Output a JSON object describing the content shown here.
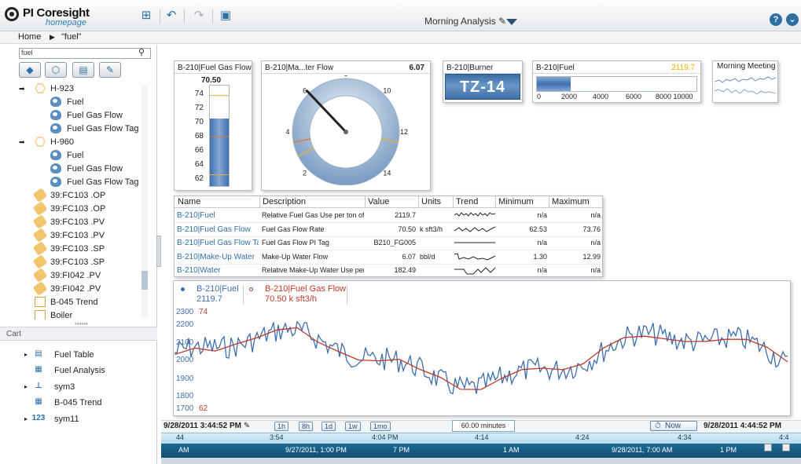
{
  "app": {
    "name": "PI Coresight",
    "subtitle": "homepage"
  },
  "toolbar": {
    "display_title": "Morning Analysis"
  },
  "breadcrumb": {
    "home": "Home",
    "current": "\"fuel\""
  },
  "search": {
    "value": "fuel"
  },
  "tree": [
    {
      "label": "H-923",
      "type": "element",
      "expandable": true
    },
    {
      "label": "Fuel",
      "type": "attribute"
    },
    {
      "label": "Fuel Gas Flow",
      "type": "attribute"
    },
    {
      "label": "Fuel Gas Flow Tag",
      "type": "attribute"
    },
    {
      "label": "H-960",
      "type": "element",
      "expandable": true
    },
    {
      "label": "Fuel",
      "type": "attribute"
    },
    {
      "label": "Fuel Gas Flow",
      "type": "attribute"
    },
    {
      "label": "Fuel Gas Flow Tag",
      "type": "attribute"
    },
    {
      "label": "39:FC103 .OP",
      "type": "tag"
    },
    {
      "label": "39:FC103 .OP",
      "type": "tag"
    },
    {
      "label": "39:FC103 .PV",
      "type": "tag"
    },
    {
      "label": "39:FC103 .PV",
      "type": "tag"
    },
    {
      "label": "39:FC103 .SP",
      "type": "tag"
    },
    {
      "label": "39:FC103 .SP",
      "type": "tag"
    },
    {
      "label": "39:FI042 .PV",
      "type": "tag"
    },
    {
      "label": "39:FI042 .PV",
      "type": "tag"
    },
    {
      "label": "B-045 Trend",
      "type": "display"
    },
    {
      "label": "Boiler",
      "type": "display"
    }
  ],
  "cart": {
    "title": "Cart",
    "items": [
      {
        "label": "Fuel Table",
        "icon": "table-icon",
        "glyph": "▤",
        "expandable": true
      },
      {
        "label": "Fuel Analysis",
        "icon": "display-icon",
        "glyph": "▦",
        "expandable": false
      },
      {
        "label": "sym3",
        "icon": "trend-icon",
        "glyph": "⊥",
        "expandable": true
      },
      {
        "label": "B-045 Trend",
        "icon": "display-icon",
        "glyph": "▦",
        "expandable": false
      },
      {
        "label": "sym11",
        "icon": "value-icon",
        "glyph": "123",
        "expandable": true
      }
    ]
  },
  "tank": {
    "title": "B-210|Fuel Gas Flow",
    "value": "70.50",
    "ticks": [
      "74",
      "72",
      "70",
      "68",
      "66",
      "64",
      "62"
    ],
    "min": 61,
    "max": 75.2,
    "level": 70.5
  },
  "gauge": {
    "title": "B-210|Ma...ter Flow",
    "value": "6.07",
    "ticks": [
      "6",
      "8",
      "10",
      "12",
      "14",
      "2",
      "4"
    ],
    "level": 6.07
  },
  "value_symbol": {
    "title": "B-210|Burner",
    "value": "TZ-14"
  },
  "bar": {
    "title": "B-210|Fuel",
    "value": "2119.7",
    "ticks": [
      "0",
      "2000",
      "4000",
      "6000",
      "8000 10000"
    ],
    "max": 10000,
    "level": 2119.7
  },
  "sparkline": {
    "title": "Morning Meeting"
  },
  "table": {
    "columns": [
      "Name",
      "Description",
      "Value",
      "Units",
      "Trend",
      "Minimum",
      "Maximum"
    ],
    "rows": [
      {
        "name": "B-210|Fuel",
        "desc": "Relative Fuel Gas Use per ton of Fee",
        "value": "2119.7",
        "units": "",
        "min": "n/a",
        "max": "n/a"
      },
      {
        "name": "B-210|Fuel Gas Flow",
        "desc": "Fuel Gas Flow Rate",
        "value": "70.50",
        "units": "k sft3/h",
        "min": "62.53",
        "max": "73.76"
      },
      {
        "name": "B-210|Fuel Gas Flow Ta",
        "desc": "Fuel Gas Flow PI Tag",
        "value": "B210_FG005",
        "units": "",
        "min": "n/a",
        "max": "n/a"
      },
      {
        "name": "B-210|Make-Up Water",
        "desc": "Make-Up Water Flow",
        "value": "6.07",
        "units": "bbl/d",
        "min": "1.30",
        "max": "12.99"
      },
      {
        "name": "B-210|Water",
        "desc": "Relative Make-Up Water Use per tor",
        "value": "182.49",
        "units": "",
        "min": "n/a",
        "max": "n/a"
      }
    ]
  },
  "trend": {
    "legend": [
      {
        "name": "B-210|Fuel",
        "value": "2119.7",
        "color": "#3e6fae"
      },
      {
        "name": "B-210|Fuel Gas Flow",
        "value": "70.50  k sft3/h",
        "color": "#c0392b"
      }
    ],
    "y_left": [
      "2300",
      "2200",
      "2100",
      "2000",
      "1900",
      "1800",
      "1700"
    ],
    "y_right_top": "74",
    "y_right_bottom": "62"
  },
  "timebar": {
    "start": "9/28/2011 3:44:52 PM",
    "end": "9/28/2011 4:44:52 PM",
    "duration": "60.00 minutes",
    "ranges": [
      "1h",
      "8h",
      "1d",
      "1w",
      "1mo"
    ],
    "now_label": "Now",
    "axis_top": [
      "44",
      "3:54",
      "4:04 PM",
      "4:14",
      "4:24",
      "4:34",
      "4:4"
    ],
    "axis_bottom": [
      "AM",
      "9/27/2011, 1:00 PM",
      "7 PM",
      "1 AM",
      "9/28/2011, 7:00 AM",
      "1 PM"
    ]
  },
  "colors": {
    "accent": "#2f6fa5",
    "trend_blue": "#3e6fae",
    "trend_red": "#c0392b",
    "gold": "#f2b200"
  }
}
